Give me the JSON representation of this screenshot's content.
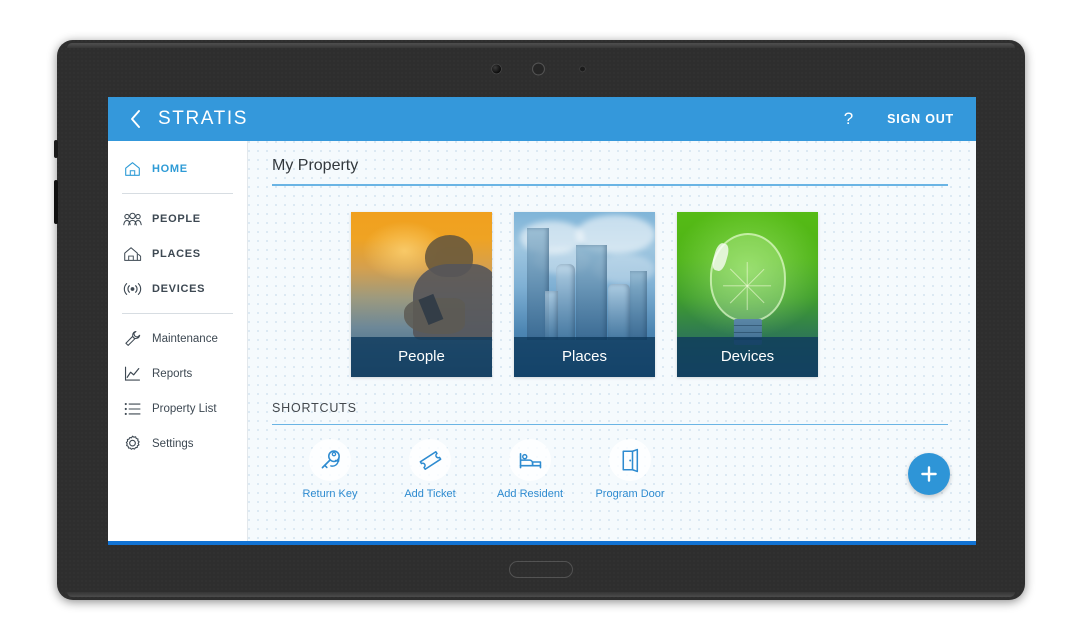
{
  "app": {
    "title": "STRATIS",
    "back_icon": "chevron-left-icon",
    "help_label": "?",
    "sign_out_label": "SIGN OUT",
    "accent_color": "#3498db",
    "bottom_bar_color": "#1273d4"
  },
  "sidebar": {
    "primary_items": [
      {
        "label": "HOME",
        "icon": "home-icon",
        "active": true
      },
      {
        "label": "PEOPLE",
        "icon": "people-icon",
        "active": false
      },
      {
        "label": "PLACES",
        "icon": "house-icon",
        "active": false
      },
      {
        "label": "DEVICES",
        "icon": "antenna-icon",
        "active": false
      }
    ],
    "secondary_items": [
      {
        "label": "Maintenance",
        "icon": "wrench-icon"
      },
      {
        "label": "Reports",
        "icon": "chart-line-icon"
      },
      {
        "label": "Property List",
        "icon": "list-icon"
      },
      {
        "label": "Settings",
        "icon": "gear-icon"
      }
    ]
  },
  "main": {
    "property_section_title": "My Property",
    "cards": [
      {
        "label": "People",
        "art": "sunset-person-silhouette"
      },
      {
        "label": "Places",
        "art": "city-skyscrapers"
      },
      {
        "label": "Devices",
        "art": "green-lightbulb"
      }
    ],
    "shortcuts_section_title": "SHORTCUTS",
    "shortcuts": [
      {
        "label": "Return Key",
        "icon": "key-return-icon"
      },
      {
        "label": "Add Ticket",
        "icon": "ticket-icon"
      },
      {
        "label": "Add Resident",
        "icon": "bed-icon"
      },
      {
        "label": "Program Door",
        "icon": "open-door-icon"
      }
    ],
    "fab": {
      "label": "+",
      "icon": "plus-icon",
      "color": "#2e95d7"
    }
  }
}
